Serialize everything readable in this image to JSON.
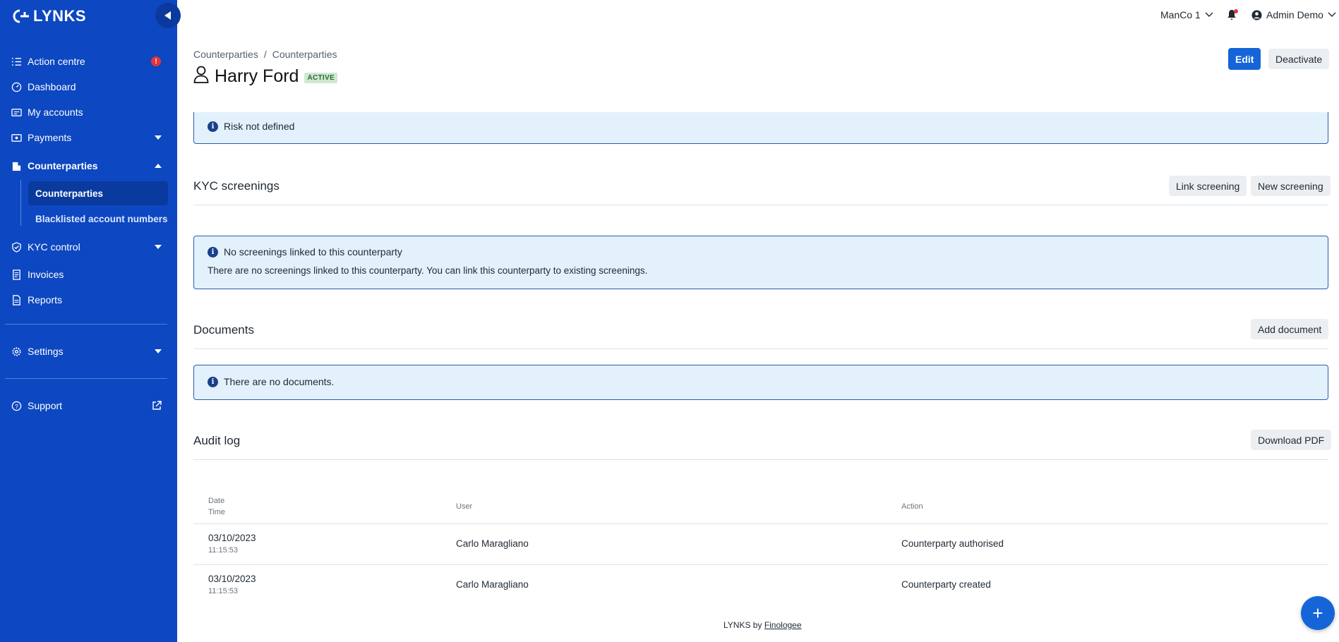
{
  "brand": {
    "name": "LYNKS",
    "color": "#0d47c1"
  },
  "sidebar": {
    "items": [
      {
        "label": "Action centre",
        "icon": "list-check-icon",
        "alert": "!"
      },
      {
        "label": "Dashboard",
        "icon": "gauge-icon"
      },
      {
        "label": "My accounts",
        "icon": "accounts-icon"
      },
      {
        "label": "Payments",
        "icon": "money-icon"
      },
      {
        "label": "Counterparties",
        "icon": "building-icon"
      },
      {
        "label": "KYC control",
        "icon": "shield-check-icon"
      },
      {
        "label": "Invoices",
        "icon": "invoice-icon"
      },
      {
        "label": "Reports",
        "icon": "report-icon"
      },
      {
        "label": "Settings",
        "icon": "gear-icon"
      },
      {
        "label": "Support",
        "icon": "help-circle-icon"
      }
    ],
    "sub_items": [
      {
        "label": "Counterparties"
      },
      {
        "label": "Blacklisted account numbers"
      }
    ]
  },
  "topbar": {
    "company": "ManCo 1",
    "user": "Admin Demo"
  },
  "header": {
    "breadcrumb": [
      "Counterparties",
      "/",
      "Counterparties"
    ],
    "title": "Harry Ford",
    "status": "ACTIVE",
    "edit_label": "Edit",
    "deactivate_label": "Deactivate"
  },
  "risk": {
    "message": "Risk not defined"
  },
  "kyc": {
    "title": "KYC screenings",
    "link_label": "Link screening",
    "new_label": "New screening",
    "empty_title": "No screenings linked to this counterparty",
    "empty_text": "There are no screenings linked to this counterparty. You can link this counterparty to existing screenings."
  },
  "documents": {
    "title": "Documents",
    "add_label": "Add document",
    "empty_text": "There are no documents."
  },
  "audit": {
    "title": "Audit log",
    "download_label": "Download PDF",
    "columns": {
      "date": "Date",
      "time": "Time",
      "user": "User",
      "action": "Action"
    },
    "rows": [
      {
        "date": "03/10/2023",
        "time": "11:15:53",
        "user": "Carlo Maragliano",
        "action": "Counterparty authorised"
      },
      {
        "date": "03/10/2023",
        "time": "11:15:53",
        "user": "Carlo Maragliano",
        "action": "Counterparty created"
      }
    ]
  },
  "footer": {
    "prefix": "LYNKS by",
    "link": "Finologee"
  },
  "fab": {
    "label": "+"
  }
}
